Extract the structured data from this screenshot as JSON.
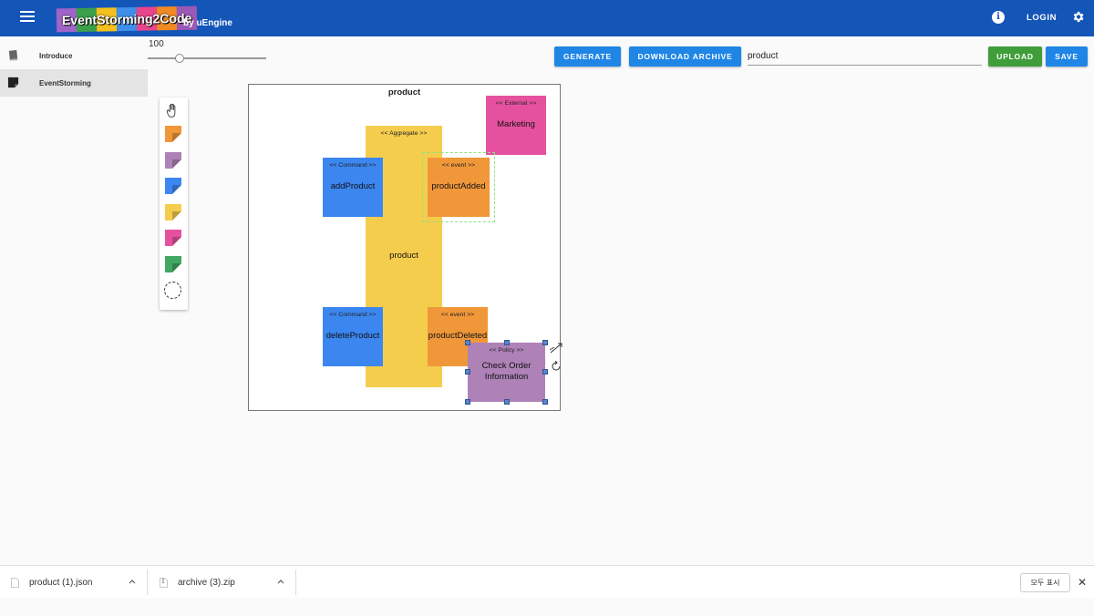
{
  "header": {
    "logo_text": "EventStorming2Code",
    "byline": "by uEngine",
    "logo_tile_colors": [
      "#a064c8",
      "#3aa14a",
      "#f4c11c",
      "#3f8ee9",
      "#e8458b",
      "#f08a24",
      "#9b59b6"
    ],
    "login_label": "LOGIN",
    "info_icon": "info-icon",
    "settings_icon": "gear-icon",
    "bar_color": "#1455b8"
  },
  "sidebar": {
    "items": [
      {
        "label": "Introduce",
        "icon": "book-icon",
        "active": false
      },
      {
        "label": "EventStorming",
        "icon": "sticky-note-icon",
        "active": true
      }
    ]
  },
  "toolbar": {
    "zoom_value": "100",
    "zoom_fraction": 0.25,
    "generate_label": "GENERATE",
    "download_label": "DOWNLOAD ARCHIVE",
    "project_name": "product",
    "upload_label": "UPLOAD",
    "save_label": "SAVE"
  },
  "palette": {
    "items": [
      {
        "icon": "hand-icon"
      },
      {
        "icon": "event-sticker-icon",
        "color": "#f0973a"
      },
      {
        "icon": "policy-sticker-icon",
        "color": "#ae82b7"
      },
      {
        "icon": "command-sticker-icon",
        "color": "#3c86f0"
      },
      {
        "icon": "aggregate-sticker-icon",
        "color": "#f5cd4d"
      },
      {
        "icon": "external-sticker-icon",
        "color": "#e6519f"
      },
      {
        "icon": "view-sticker-icon",
        "color": "#3fa863"
      },
      {
        "icon": "bounded-context-icon"
      }
    ]
  },
  "canvas": {
    "title": "product",
    "stickers": {
      "aggregate": {
        "stereotype": "<< Aggregate >>",
        "name": "product",
        "color": "#f5cd4d"
      },
      "external": {
        "stereotype": "<< External >>",
        "name": "Marketing",
        "color": "#e6519f"
      },
      "command1": {
        "stereotype": "<< Command >>",
        "name": "addProduct",
        "color": "#3c86f0"
      },
      "event1": {
        "stereotype": "<< event >>",
        "name": "productAdded",
        "color": "#f0973a"
      },
      "command2": {
        "stereotype": "<< Command >>",
        "name": "deleteProduct",
        "color": "#3c86f0"
      },
      "event2": {
        "stereotype": "<< event >>",
        "name": "productDeleted",
        "color": "#f0973a"
      },
      "policy": {
        "stereotype": "<< Policy >>",
        "name_line1": "Check Order",
        "name_line2": "Information",
        "color": "#ae82b7"
      }
    }
  },
  "downloads": {
    "items": [
      {
        "name": "product (1).json"
      },
      {
        "name": "archive (3).zip"
      }
    ],
    "show_all_label": "모두 표시",
    "close_label": "✕"
  }
}
